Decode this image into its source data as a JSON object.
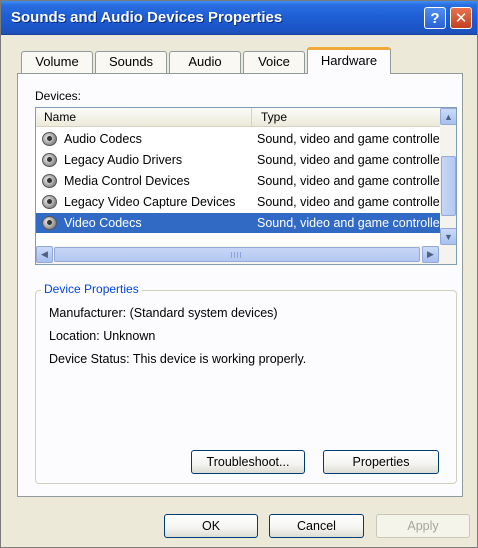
{
  "window": {
    "title": "Sounds and Audio Devices Properties",
    "help_label": "?",
    "close_label": "✕"
  },
  "tabs": [
    {
      "label": "Volume"
    },
    {
      "label": "Sounds"
    },
    {
      "label": "Audio"
    },
    {
      "label": "Voice"
    },
    {
      "label": "Hardware",
      "active": true
    }
  ],
  "devices": {
    "label": "Devices:",
    "columns": [
      "Name",
      "Type"
    ],
    "rows": [
      {
        "name": "Audio Codecs",
        "type": "Sound, video and game controllers"
      },
      {
        "name": "Legacy Audio Drivers",
        "type": "Sound, video and game controllers"
      },
      {
        "name": "Media Control Devices",
        "type": "Sound, video and game controllers"
      },
      {
        "name": "Legacy Video Capture Devices",
        "type": "Sound, video and game controllers"
      },
      {
        "name": "Video Codecs",
        "type": "Sound, video and game controllers",
        "selected": true
      }
    ]
  },
  "device_properties": {
    "title": "Device Properties",
    "manufacturer": "Manufacturer: (Standard system devices)",
    "location": "Location: Unknown",
    "status": "Device Status: This device is working properly.",
    "troubleshoot_label": "Troubleshoot...",
    "properties_label": "Properties"
  },
  "footer": {
    "ok_label": "OK",
    "cancel_label": "Cancel",
    "apply_label": "Apply"
  },
  "colors": {
    "titlebar": "#1f5fd6",
    "selection": "#316ac5",
    "group_title": "#0046d5",
    "active_tab_accent": "#f0a838"
  }
}
